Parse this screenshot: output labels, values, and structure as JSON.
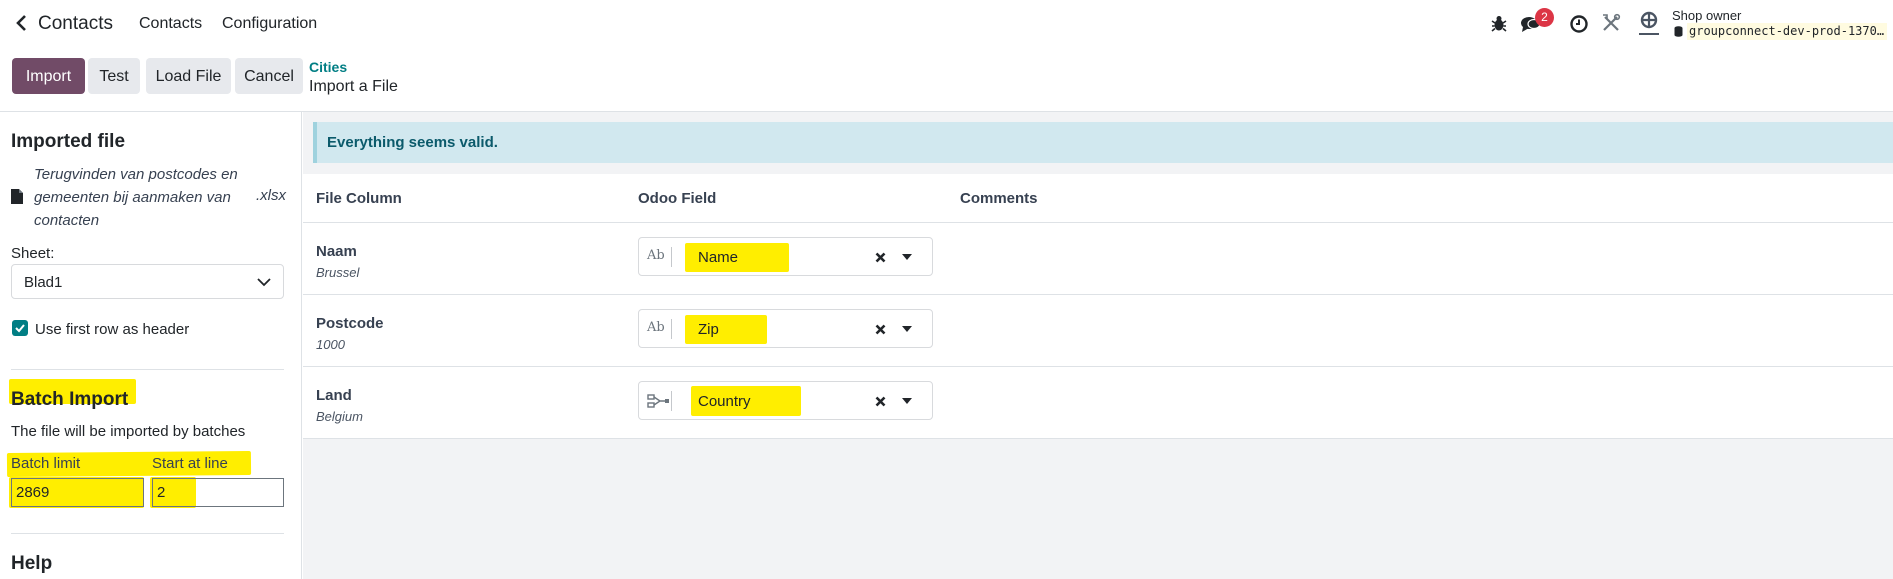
{
  "navbar": {
    "app_title": "Contacts",
    "menu": [
      "Contacts",
      "Configuration"
    ],
    "message_count": "2",
    "user_role": "Shop owner",
    "database": "groupconnect-dev-prod-1370…",
    "icons": [
      "bug-icon",
      "messages-icon",
      "clock-icon",
      "tools-icon",
      "company-logo-icon"
    ]
  },
  "control_panel": {
    "buttons": {
      "import": "Import",
      "test": "Test",
      "load_file": "Load File",
      "cancel": "Cancel"
    },
    "breadcrumb_parent": "Cities",
    "breadcrumb_current": "Import a File",
    "primary_color": "#714b67"
  },
  "sidebar": {
    "imported_file_title": "Imported file",
    "file_name": "Terugvinden van postcodes en gemeenten bij aanmaken van contacten",
    "file_ext": ".xlsx",
    "sheet_label": "Sheet:",
    "sheet_value": "Blad1",
    "use_header_label": "Use first row as header",
    "use_header_checked": true,
    "batch_title": "Batch Import",
    "batch_desc": "The file will be imported by batches",
    "batch_limit_label": "Batch limit",
    "batch_limit_value": "2869",
    "start_line_label": "Start at line",
    "start_line_value": "2",
    "help_title": "Help"
  },
  "main": {
    "alert": "Everything seems valid.",
    "headers": {
      "file_column": "File Column",
      "odoo_field": "Odoo Field",
      "comments": "Comments"
    },
    "rows": [
      {
        "column": "Naam",
        "sample": "Brussel",
        "field": "Name",
        "type_icon": "text-type-icon"
      },
      {
        "column": "Postcode",
        "sample": "1000",
        "field": "Zip",
        "type_icon": "text-type-icon"
      },
      {
        "column": "Land",
        "sample": "Belgium",
        "field": "Country",
        "type_icon": "relation-type-icon"
      }
    ]
  },
  "annotation": {
    "highlight_color": "#ffee00"
  }
}
